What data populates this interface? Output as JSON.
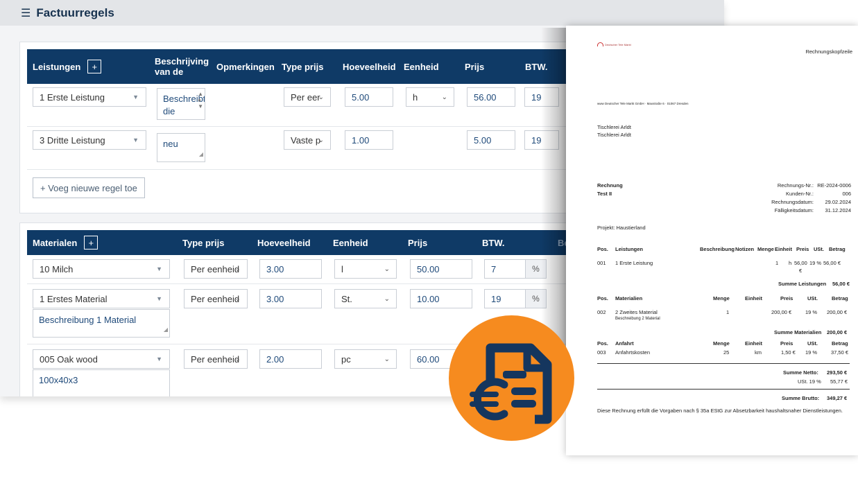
{
  "app": {
    "header_icon": "hamburger-icon",
    "title": "Factuurregels",
    "services": {
      "header": {
        "label": "Leistungen",
        "add": "+",
        "col_desc": "Beschrijving van de",
        "col_notes": "Opmerkingen",
        "col_price_type": "Type prijs",
        "col_qty": "Hoeveelheid",
        "col_unit": "Eenheid",
        "col_price": "Prijs",
        "col_vat": "BTW."
      },
      "rows": [
        {
          "item": "1 Erste Leistung",
          "desc": "Beschreibt die erste",
          "price_type": "Per eer",
          "qty": "5.00",
          "unit": "h",
          "price": "56.00",
          "vat": "19"
        },
        {
          "item": "3 Dritte Leistung",
          "desc": "neu",
          "price_type": "Vaste p",
          "qty": "1.00",
          "unit": "",
          "price": "5.00",
          "vat": "19"
        }
      ],
      "add_line": "+ Voeg nieuwe regel toe"
    },
    "materials": {
      "header": {
        "label": "Materialen",
        "add": "+",
        "col_price_type": "Type prijs",
        "col_qty": "Hoeveelheid",
        "col_unit": "Eenheid",
        "col_price": "Prijs",
        "col_vat": "BTW.",
        "col_cut": "Be"
      },
      "rows": [
        {
          "item": "10 Milch",
          "desc": "",
          "price_type": "Per eenheid",
          "qty": "3.00",
          "unit": "l",
          "price": "50.00",
          "vat": "7",
          "pct": "%"
        },
        {
          "item": "1 Erstes Material",
          "desc": "Beschreibung 1 Material",
          "price_type": "Per eenheid",
          "qty": "3.00",
          "unit": "St.",
          "price": "10.00",
          "vat": "19",
          "pct": "%"
        },
        {
          "item": "005 Oak wood",
          "desc": "100x40x3",
          "price_type": "Per eenheid",
          "qty": "2.00",
          "unit": "pc",
          "price": "60.00",
          "vat": "",
          "pct": ""
        }
      ]
    }
  },
  "invoice": {
    "logo_text": "Deutscher Tele Markt",
    "header_right": "Rechnungskopfzeile",
    "sender_line": "www Deutscher Tele Markt GmbH · Maxstraße 6 · 01067 Dresden",
    "recipient": [
      "Tischlerei Arldt",
      "Tischlerei Arldt"
    ],
    "doc_title": "Rechnung",
    "doc_subtitle": "Test II",
    "meta": [
      {
        "label": "Rechnungs-Nr.:",
        "value": "RE-2024-0006"
      },
      {
        "label": "Kunden-Nr.:",
        "value": "006"
      },
      {
        "label": "Rechnungsdatum:",
        "value": "29.02.2024"
      },
      {
        "label": "Fälligkeitsdatum:",
        "value": "31.12.2024"
      }
    ],
    "project": "Projekt: Haustierland",
    "services_head": [
      "Pos.",
      "Leistungen",
      "Beschreibung",
      "Notizen",
      "Menge",
      "Einheit",
      "Preis",
      "USt.",
      "Betrag"
    ],
    "services_row": {
      "pos": "001",
      "name": "1 Erste Leistung",
      "qty": "1",
      "unit": "h",
      "price": "56,00",
      "price_cur": "€",
      "vat": "19 %",
      "amount": "56,00 €"
    },
    "services_sum": {
      "label": "Summe Leistungen",
      "value": "56,00 €"
    },
    "materials_head": [
      "Pos.",
      "Materialien",
      "Menge",
      "Einheit",
      "Preis",
      "USt.",
      "Betrag"
    ],
    "materials_row": {
      "pos": "002",
      "name": "2 Zweites Material",
      "desc": "Beschreibung 2 Material",
      "qty": "1",
      "unit": "",
      "price": "200,00 €",
      "vat": "19 %",
      "amount": "200,00 €"
    },
    "materials_sum": {
      "label": "Summe Materialien",
      "value": "200,00 €"
    },
    "travel_head": [
      "Pos.",
      "Anfahrt",
      "Menge",
      "Einheit",
      "Preis",
      "USt.",
      "Betrag"
    ],
    "travel_row": {
      "pos": "003",
      "name": "Anfahrtskosten",
      "qty": "25",
      "unit": "km",
      "price": "1,50 €",
      "vat": "19 %",
      "amount": "37,50 €"
    },
    "net": {
      "label": "Summe Netto:",
      "value": "293,50 €"
    },
    "tax": {
      "label": "USt. 19 %",
      "value": "55,77 €"
    },
    "gross": {
      "label": "Summe Brutto:",
      "value": "349,27 €"
    },
    "footer": "Diese Rechnung erfüllt die Vorgaben nach § 35a EStG zur Absetzbarkeit haushaltsnaher Dienstleistungen."
  },
  "badge": {
    "icon": "invoice-euro-icon",
    "color": "#f68b1f"
  }
}
